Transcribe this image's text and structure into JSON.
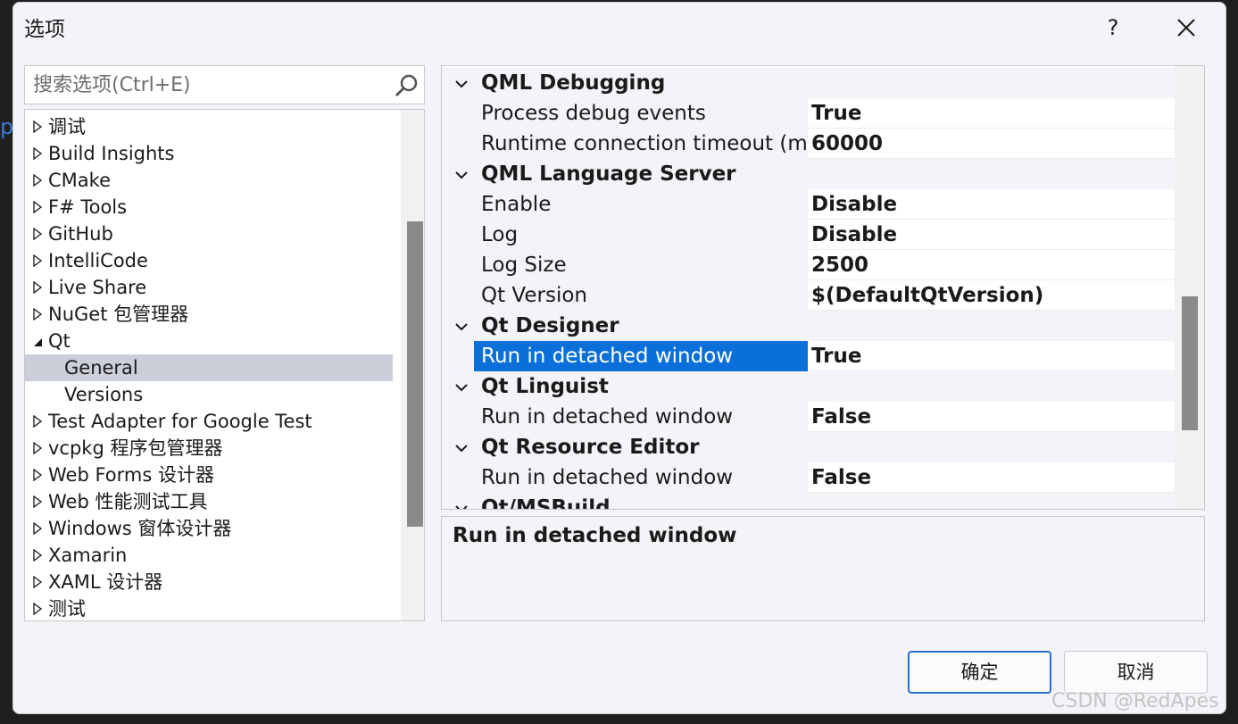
{
  "window": {
    "title": "选项",
    "help_label": "?"
  },
  "search": {
    "placeholder": "搜索选项(Ctrl+E)"
  },
  "tree": {
    "items": [
      {
        "label": "调试",
        "state": "collapsed"
      },
      {
        "label": "Build Insights",
        "state": "collapsed"
      },
      {
        "label": "CMake",
        "state": "collapsed"
      },
      {
        "label": "F# Tools",
        "state": "collapsed"
      },
      {
        "label": "GitHub",
        "state": "collapsed"
      },
      {
        "label": "IntelliCode",
        "state": "collapsed"
      },
      {
        "label": "Live Share",
        "state": "collapsed"
      },
      {
        "label": "NuGet 包管理器",
        "state": "collapsed"
      },
      {
        "label": "Qt",
        "state": "expanded"
      },
      {
        "label": "General",
        "state": "leaf",
        "selected": true
      },
      {
        "label": "Versions",
        "state": "leaf"
      },
      {
        "label": "Test Adapter for Google Test",
        "state": "collapsed"
      },
      {
        "label": "vcpkg 程序包管理器",
        "state": "collapsed"
      },
      {
        "label": "Web Forms 设计器",
        "state": "collapsed"
      },
      {
        "label": "Web 性能测试工具",
        "state": "collapsed"
      },
      {
        "label": "Windows 窗体设计器",
        "state": "collapsed"
      },
      {
        "label": "Xamarin",
        "state": "collapsed"
      },
      {
        "label": "XAML 设计器",
        "state": "collapsed"
      },
      {
        "label": "测试",
        "state": "collapsed"
      }
    ]
  },
  "grid": {
    "rows": [
      {
        "type": "category",
        "label": "QML Debugging"
      },
      {
        "type": "property",
        "label": "Process debug events",
        "value": "True"
      },
      {
        "type": "property",
        "label": "Runtime connection timeout (m",
        "value": "60000"
      },
      {
        "type": "category",
        "label": "QML Language Server"
      },
      {
        "type": "property",
        "label": "Enable",
        "value": "Disable"
      },
      {
        "type": "property",
        "label": "Log",
        "value": "Disable"
      },
      {
        "type": "property",
        "label": "Log Size",
        "value": "2500"
      },
      {
        "type": "property",
        "label": "Qt Version",
        "value": "$(DefaultQtVersion)"
      },
      {
        "type": "category",
        "label": "Qt Designer"
      },
      {
        "type": "property",
        "label": "Run in detached window",
        "value": "True",
        "selected": true
      },
      {
        "type": "category",
        "label": "Qt Linguist"
      },
      {
        "type": "property",
        "label": "Run in detached window",
        "value": "False"
      },
      {
        "type": "category",
        "label": "Qt Resource Editor"
      },
      {
        "type": "property",
        "label": "Run in detached window",
        "value": "False"
      },
      {
        "type": "category",
        "label": "Qt/MSBuild"
      }
    ]
  },
  "description": {
    "title": "Run in detached window"
  },
  "buttons": {
    "ok": "确定",
    "cancel": "取消"
  },
  "watermark": "CSDN @RedApes",
  "colors": {
    "selection": "#0a6fd8",
    "tree_selection": "#ccced9",
    "ok_border": "#2a6ec8"
  }
}
